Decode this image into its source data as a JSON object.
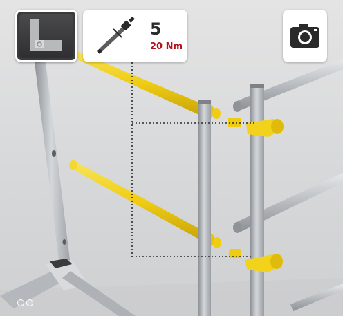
{
  "toolbar": {
    "step_icon": "corner-bracket-icon",
    "tool_icon": "torque-wrench-icon",
    "tool_count": "5",
    "torque": "20 Nm",
    "camera_icon": "camera-icon"
  },
  "pagination": {
    "total": 3,
    "current": 1
  },
  "colors": {
    "handrail_yellow": "#f2d21b",
    "torque_text": "#b3121f",
    "frame_gray": "#a9adb1"
  }
}
